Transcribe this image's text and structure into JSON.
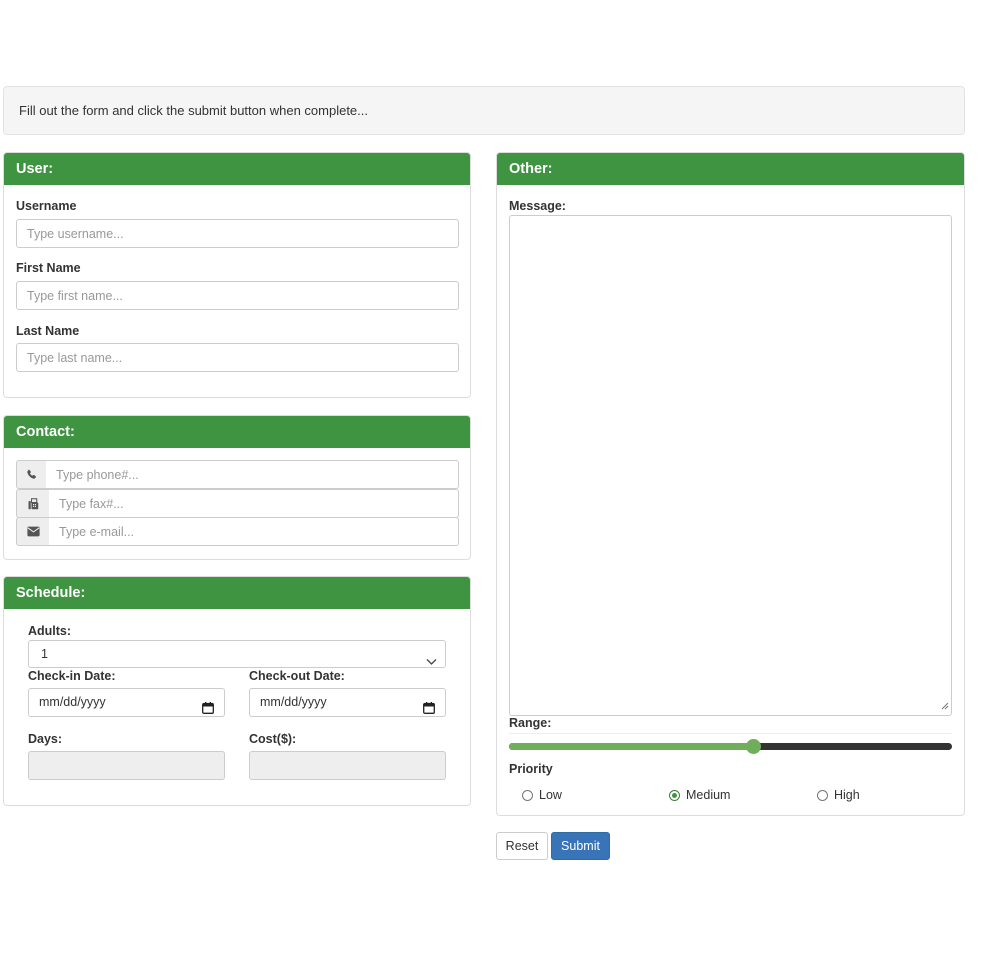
{
  "instructions": "Fill out the form and click the submit button when complete...",
  "user_panel": {
    "title": "User:",
    "username_label": "Username",
    "username_placeholder": "Type username...",
    "firstname_label": "First Name",
    "firstname_placeholder": "Type first name...",
    "lastname_label": "Last Name",
    "lastname_placeholder": "Type last name..."
  },
  "contact_panel": {
    "title": "Contact:",
    "phone_icon": "phone-icon",
    "phone_placeholder": "Type phone#...",
    "fax_icon": "fax-icon",
    "fax_placeholder": "Type fax#...",
    "email_icon": "envelope-icon",
    "email_placeholder": "Type e-mail..."
  },
  "schedule_panel": {
    "title": "Schedule:",
    "adults_label": "Adults:",
    "adults_value": "1",
    "checkin_label": "Check-in Date:",
    "checkin_value": "mm/dd/yyyy",
    "checkout_label": "Check-out Date:",
    "checkout_value": "mm/dd/yyyy",
    "days_label": "Days:",
    "cost_label": "Cost($):"
  },
  "other_panel": {
    "title": "Other:",
    "message_label": "Message:",
    "range_label": "Range:",
    "range_value_fraction": 0.55,
    "priority_label": "Priority",
    "priority_options": [
      "Low",
      "Medium",
      "High"
    ],
    "priority_selected": "Medium"
  },
  "buttons": {
    "reset_label": "Reset",
    "submit_label": "Submit"
  },
  "colors": {
    "panel_header": "#3f9442",
    "range_fill": "#6fae5a",
    "submit_button": "#3a74b8"
  }
}
